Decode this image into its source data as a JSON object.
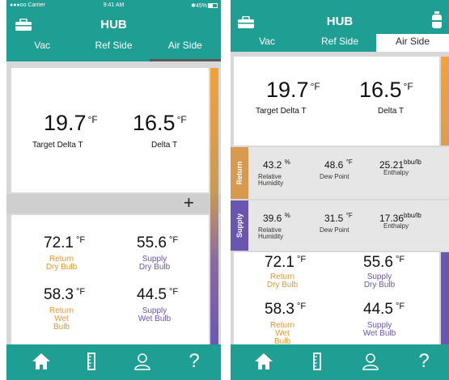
{
  "status_bar": {
    "carrier": "●●●oo Carrier",
    "time": "9:41 AM",
    "battery": "45%"
  },
  "app": {
    "title": "HUB"
  },
  "tabs": [
    "Vac",
    "Ref Side",
    "Air Side"
  ],
  "left": {
    "target_delta_t": {
      "value": "19.7",
      "unit": "°F",
      "label": "Target Delta T"
    },
    "delta_t": {
      "value": "16.5",
      "unit": "°F",
      "label": "Delta T"
    },
    "add_symbol": "+",
    "readings": [
      {
        "value": "72.1",
        "unit": "°F",
        "line1": "Return",
        "line2": "Dry Bulb",
        "color": "#e8962b"
      },
      {
        "value": "55.6",
        "unit": "°F",
        "line1": "Supply",
        "line2": "Dry Bulb",
        "color": "#6a56b0"
      },
      {
        "value": "58.3",
        "unit": "°F",
        "line1": "Return",
        "line2": "Wet Bulb",
        "color": "#e8962b"
      },
      {
        "value": "44.5",
        "unit": "°F",
        "line1": "Supply",
        "line2": "Wet Bulb",
        "color": "#6a56b0"
      }
    ]
  },
  "right": {
    "target_delta_t": {
      "value": "19.7",
      "unit": "°F",
      "label": "Target Delta T"
    },
    "delta_t": {
      "value": "16.5",
      "unit": "°F",
      "label": "Delta T"
    },
    "return": {
      "band_label": "Return",
      "humidity": {
        "value": "43.2",
        "unit": "%",
        "label1": "Relative",
        "label2": "Humidity"
      },
      "dew_point": {
        "value": "48.6",
        "unit": "°F",
        "label": "Dew Point"
      },
      "enthalpy": {
        "value": "25.21",
        "unit": "bbu/lb",
        "label": "Enthalpy"
      }
    },
    "supply": {
      "band_label": "Supply",
      "humidity": {
        "value": "39.6",
        "unit": "%",
        "label1": "Relative",
        "label2": "Humidity"
      },
      "dew_point": {
        "value": "31.5",
        "unit": "°F",
        "label": "Dew Point"
      },
      "enthalpy": {
        "value": "17.36",
        "unit": "bbu/lb",
        "label": "Enthalpy"
      }
    }
  },
  "footer_icons": [
    "home-icon",
    "ruler-icon",
    "person-icon",
    "help-icon"
  ],
  "help_symbol": "?",
  "colors": {
    "teal": "#1f9f93",
    "orange": "#e8962b",
    "purple": "#6a56b0",
    "return_band": "#d99a50",
    "supply_band": "#6a56b0"
  }
}
